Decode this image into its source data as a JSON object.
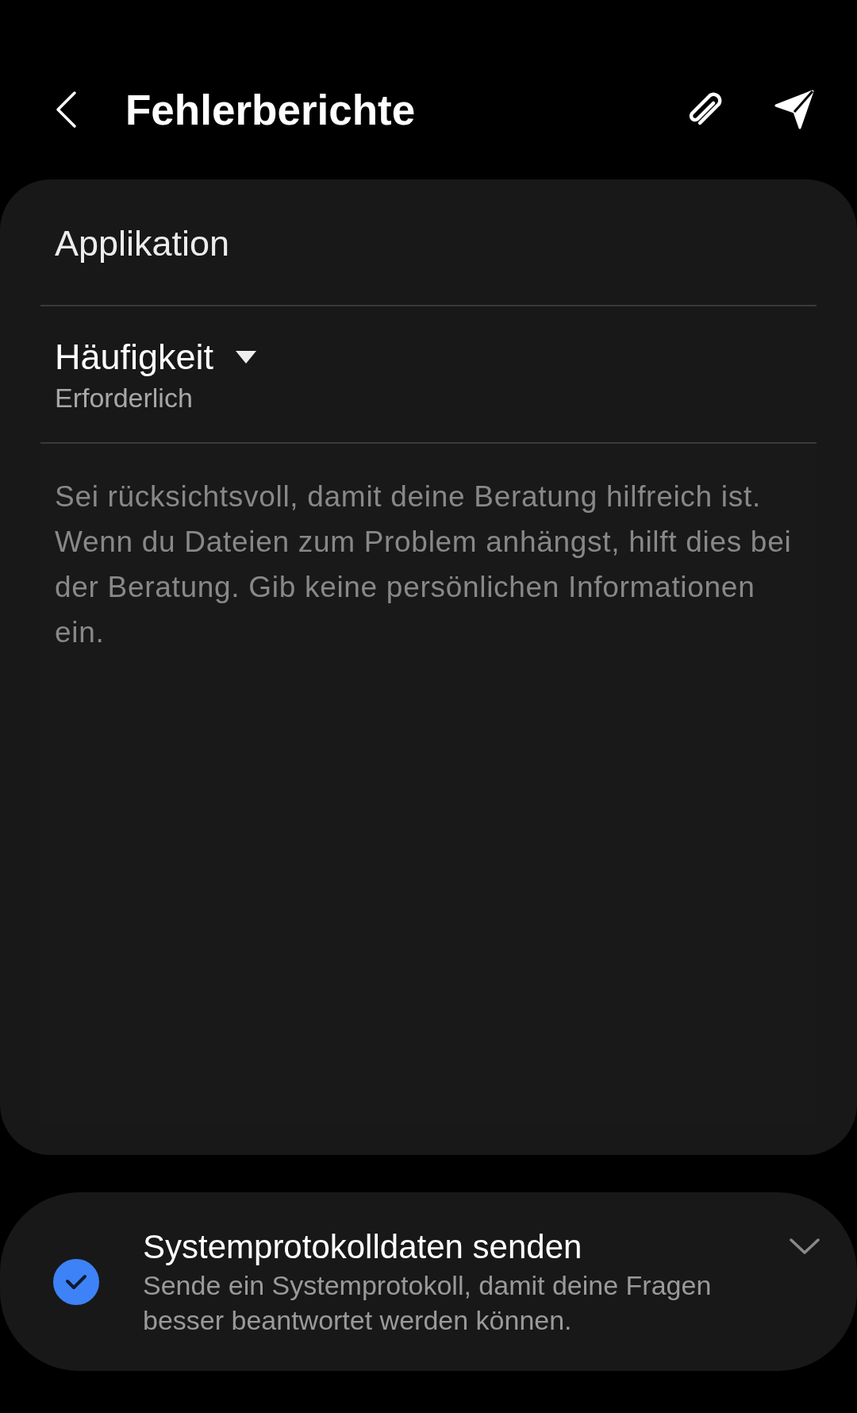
{
  "header": {
    "title": "Fehlerberichte"
  },
  "form": {
    "app_field": {
      "placeholder": "Applikation"
    },
    "frequency": {
      "label": "Häufigkeit",
      "hint": "Erforderlich"
    },
    "description": {
      "placeholder": "Sei rücksichtsvoll, damit deine Beratung hilfreich ist. Wenn du Dateien zum Problem anhängst, hilft dies bei der Beratung. Gib keine persönlichen Informationen ein."
    }
  },
  "system_log": {
    "title": "Systemprotokolldaten senden",
    "description": "Sende ein Systemprotokoll, damit deine Fragen besser beantwortet werden können.",
    "checked": true,
    "expanded": false
  }
}
